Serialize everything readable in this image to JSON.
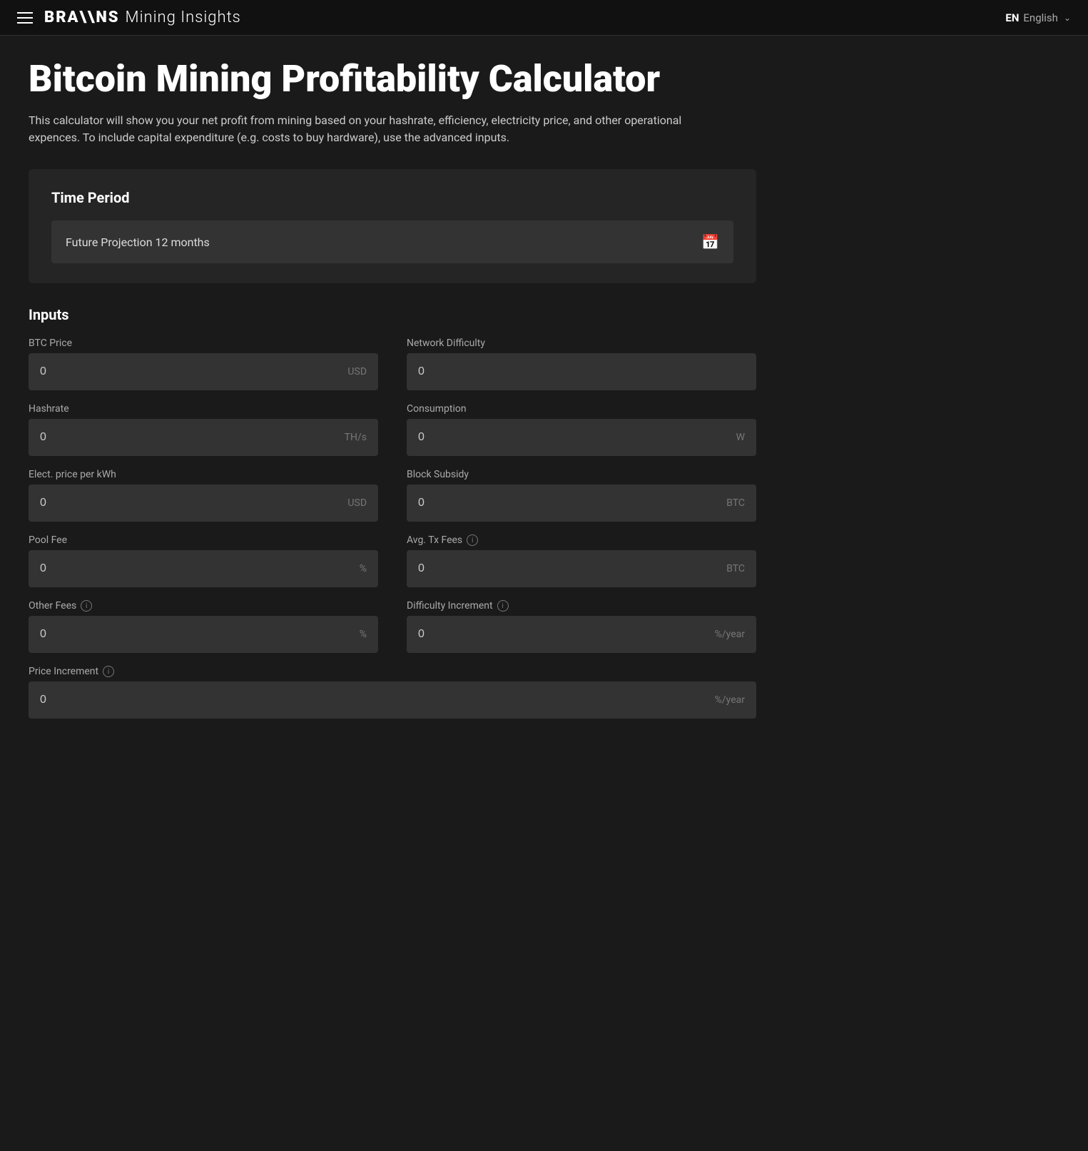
{
  "header": {
    "menu_label": "Menu",
    "logo_brand": "BRA\\\\NS",
    "logo_subtitle": "Mining Insights",
    "lang_code": "EN",
    "lang_name": "English"
  },
  "page": {
    "title": "Bitcoin Mining Profitability Calculator",
    "description": "This calculator will show you your net profit from mining based on your hashrate, efficiency, electricity price, and other operational expences. To include capital expenditure (e.g. costs to buy hardware), use the advanced inputs."
  },
  "time_period": {
    "section_title": "Time Period",
    "selected_label": "Future Projection 12 months",
    "calendar_icon": "📅"
  },
  "inputs": {
    "section_title": "Inputs",
    "fields": [
      {
        "id": "btc-price",
        "label": "BTC Price",
        "value": "0",
        "unit": "USD",
        "has_info": false,
        "full_width": false
      },
      {
        "id": "network-difficulty",
        "label": "Network Difficulty",
        "value": "0",
        "unit": "",
        "has_info": false,
        "full_width": false
      },
      {
        "id": "hashrate",
        "label": "Hashrate",
        "value": "0",
        "unit": "TH/s",
        "has_info": false,
        "full_width": false
      },
      {
        "id": "consumption",
        "label": "Consumption",
        "value": "0",
        "unit": "W",
        "has_info": false,
        "full_width": false
      },
      {
        "id": "elec-price",
        "label": "Elect. price per kWh",
        "value": "0",
        "unit": "USD",
        "has_info": false,
        "full_width": false
      },
      {
        "id": "block-subsidy",
        "label": "Block Subsidy",
        "value": "0",
        "unit": "BTC",
        "has_info": false,
        "full_width": false
      },
      {
        "id": "pool-fee",
        "label": "Pool Fee",
        "value": "0",
        "unit": "%",
        "has_info": false,
        "full_width": false
      },
      {
        "id": "avg-tx-fees",
        "label": "Avg. Tx Fees",
        "value": "0",
        "unit": "BTC",
        "has_info": true,
        "full_width": false
      },
      {
        "id": "other-fees",
        "label": "Other Fees",
        "value": "0",
        "unit": "%",
        "has_info": true,
        "full_width": false
      },
      {
        "id": "difficulty-increment",
        "label": "Difficulty Increment",
        "value": "0",
        "unit": "%/year",
        "has_info": true,
        "full_width": false
      },
      {
        "id": "price-increment",
        "label": "Price Increment",
        "value": "0",
        "unit": "%/year",
        "has_info": true,
        "full_width": true
      }
    ],
    "info_icon_char": "i"
  }
}
